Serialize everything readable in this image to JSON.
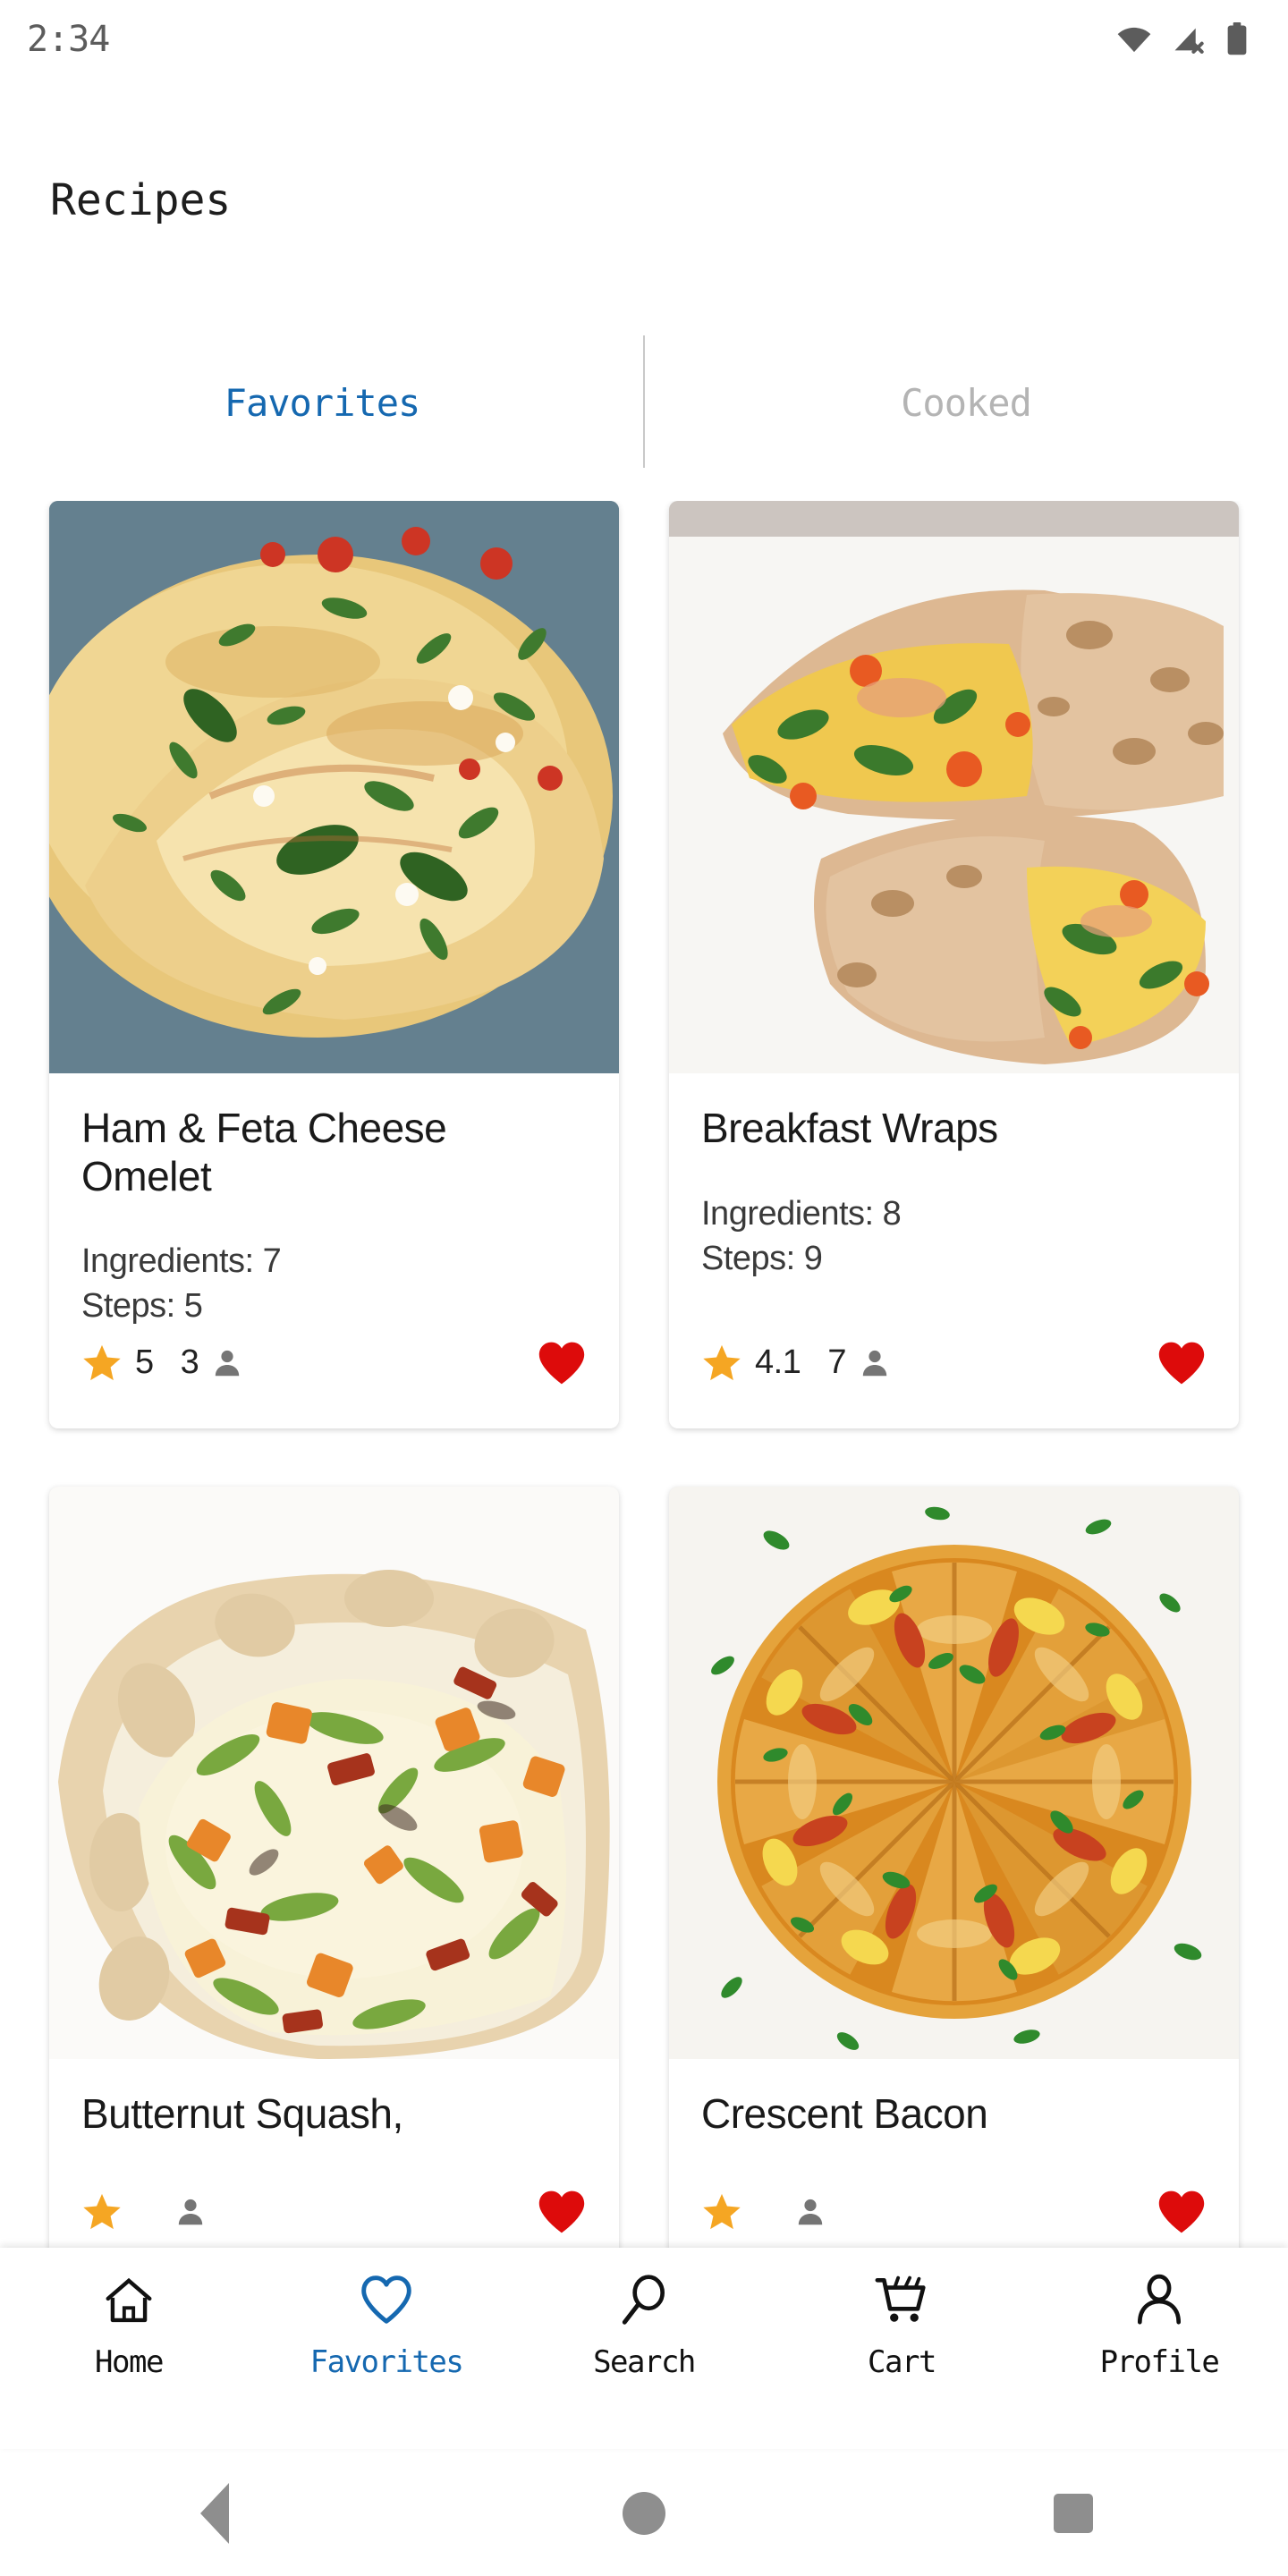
{
  "status_bar": {
    "time": "2:34",
    "icons": [
      "wifi-icon",
      "cellular-no-sim-icon",
      "battery-icon"
    ]
  },
  "header": {
    "title": "Recipes"
  },
  "tabs": [
    {
      "label": "Favorites",
      "active": true
    },
    {
      "label": "Cooked",
      "active": false
    }
  ],
  "colors": {
    "accent_blue": "#1568B0",
    "inactive_gray": "#b4b4b4",
    "star_orange": "#F5A623",
    "heart_red": "#DD0B0B",
    "person_gray": "#757575"
  },
  "recipes": [
    {
      "title": "Ham & Feta Cheese Omelet",
      "ingredients_label": "Ingredients: 7",
      "steps_label": "Steps: 5",
      "rating": "5",
      "people": "3",
      "favorited": true,
      "photo": "omelet-photo"
    },
    {
      "title": "Breakfast Wraps",
      "ingredients_label": "Ingredients: 8",
      "steps_label": "Steps: 9",
      "rating": "4.1",
      "people": "7",
      "favorited": true,
      "photo": "breakfast-wraps-photo"
    },
    {
      "title": "Butternut Squash,",
      "ingredients_label": "",
      "steps_label": "",
      "rating": "",
      "people": "",
      "favorited": true,
      "photo": "butternut-squash-quiche-photo"
    },
    {
      "title": "Crescent Bacon",
      "ingredients_label": "",
      "steps_label": "",
      "rating": "",
      "people": "",
      "favorited": true,
      "photo": "crescent-bacon-photo"
    }
  ],
  "bottom_nav": [
    {
      "label": "Home",
      "icon": "home-icon",
      "active": false
    },
    {
      "label": "Favorites",
      "icon": "heart-icon",
      "active": true
    },
    {
      "label": "Search",
      "icon": "search-icon",
      "active": false
    },
    {
      "label": "Cart",
      "icon": "cart-icon",
      "active": false
    },
    {
      "label": "Profile",
      "icon": "person-icon",
      "active": false
    }
  ],
  "system_nav": [
    {
      "label": "back-button"
    },
    {
      "label": "home-button"
    },
    {
      "label": "recents-button"
    }
  ]
}
